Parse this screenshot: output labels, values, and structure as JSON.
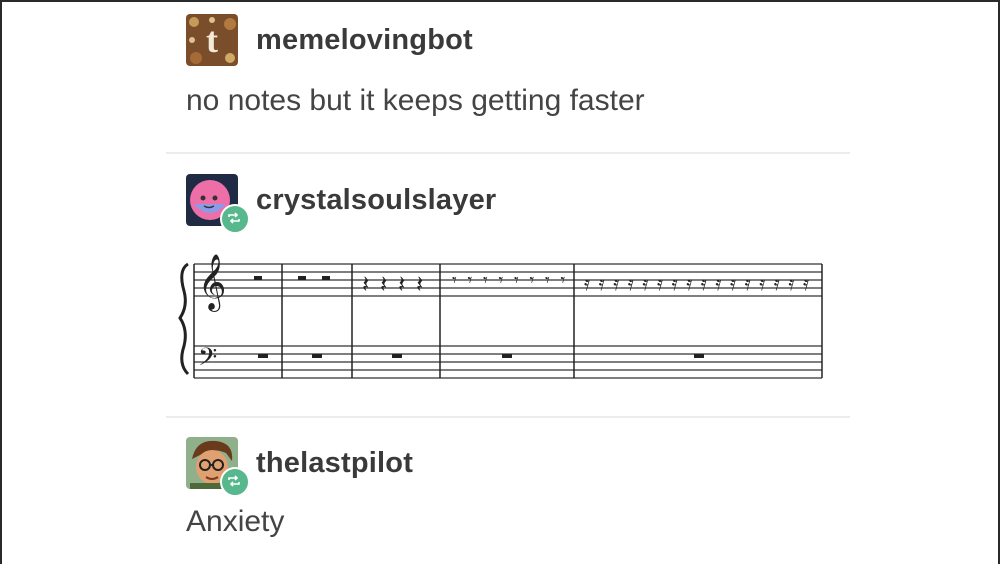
{
  "posts": [
    {
      "username": "memelovingbot",
      "text": "no notes but it keeps getting faster",
      "avatar_icon": "tumblr-t-logo-icon",
      "reblog": false
    },
    {
      "username": "crystalsoulslayer",
      "text": "",
      "avatar_icon": "pink-face-avatar-icon",
      "reblog": true,
      "attachment": "sheet-music-rests-accelerating"
    },
    {
      "username": "thelastpilot",
      "text": "Anxiety",
      "avatar_icon": "cartoon-person-glasses-avatar-icon",
      "reblog": true
    }
  ],
  "sheet_music": {
    "treble_measures": [
      "half-rest x1",
      "half-rest x2",
      "quarter-rest x4",
      "eighth-rest x8",
      "sixteenth-rest x16"
    ],
    "bass_measures": [
      "whole-rest",
      "whole-rest",
      "whole-rest",
      "whole-rest",
      "whole-rest"
    ]
  },
  "colors": {
    "reblog_badge": "#56b88c",
    "text": "#444444",
    "divider": "#ececec"
  }
}
